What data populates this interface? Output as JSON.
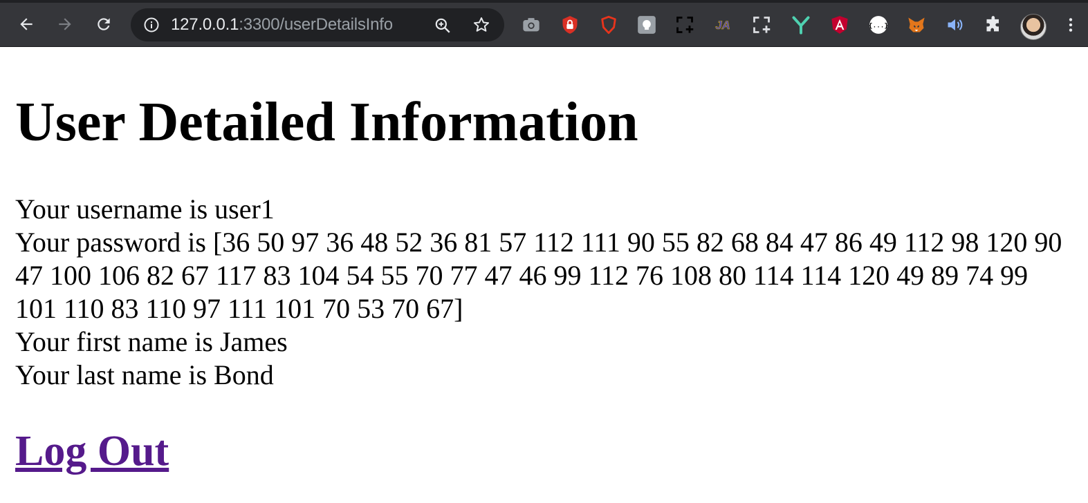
{
  "browser": {
    "url_host": "127.0.0.1",
    "url_path": ":3300/userDetailsInfo",
    "extension_icons": [
      "camera-icon",
      "lock-extension-icon",
      "brave-shield-icon",
      "lightbulb-extension-icon",
      "crop-icon",
      "ja-extension-icon",
      "crop-add-icon",
      "y-extension-icon",
      "angular-icon",
      "json-extension-icon",
      "metamask-fox-icon",
      "volume-icon",
      "puzzle-extensions-icon"
    ],
    "ja_label": "JA",
    "json_label": "{...}"
  },
  "page": {
    "title": "User Detailed Information",
    "username_line": "Your username is user1",
    "password_line": "Your password is [36 50 97 36 48 52 36 81 57 112 111 90 55 82 68 84 47 86 49 112 98 120 90 47 100 106 82 67 117 83 104 54 55 70 77 47 46 99 112 76 108 80 114 114 120 49 89 74 99 101 110 83 110 97 111 101 70 53 70 67]",
    "first_name_line": "Your first name is James",
    "last_name_line": "Your last name is Bond",
    "logout_label": "Log Out"
  }
}
